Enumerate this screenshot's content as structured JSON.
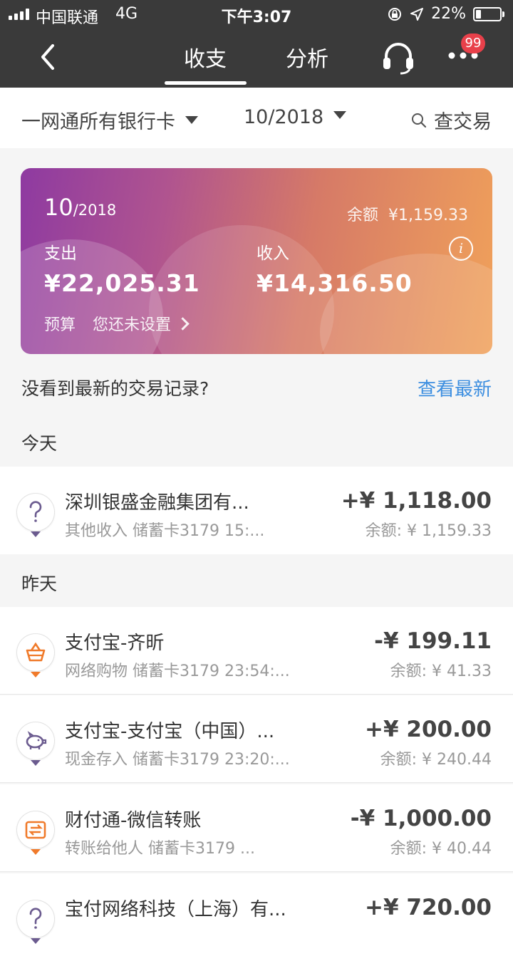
{
  "status_bar": {
    "carrier": "中国联通",
    "network": "4G",
    "time": "下午3:07",
    "battery": "22%"
  },
  "nav": {
    "tabs": [
      "收支",
      "分析"
    ],
    "active_tab": "收支",
    "badge": "99",
    "icons": [
      "back-icon",
      "headset-icon",
      "more-icon"
    ]
  },
  "filters": {
    "card": "一网通所有银行卡",
    "month": "10/2018",
    "search": "查交易"
  },
  "summary": {
    "month_main": "10",
    "month_year": "/2018",
    "balance_label": "余额",
    "balance": "¥1,159.33",
    "expense_label": "支出",
    "expense": "¥22,025.31",
    "income_label": "收入",
    "income": "¥14,316.50",
    "budget_label": "预算",
    "budget_value": "您还未设置"
  },
  "refresh": {
    "question": "没看到最新的交易记录?",
    "link": "查看最新"
  },
  "sections": {
    "today": "今天",
    "yesterday": "昨天"
  },
  "transactions": [
    {
      "title": "深圳银盛金融集团有...",
      "sub": "其他收入  储蓄卡3179 15:...",
      "amount": "+¥ 1,118.00",
      "balance": "余额: ¥ 1,159.33",
      "icon": "question-icon"
    },
    {
      "title": "支付宝-齐昕",
      "sub": "网络购物  储蓄卡3179 23:54:...",
      "amount": "-¥ 199.11",
      "balance": "余额: ¥ 41.33",
      "icon": "shopping-basket-icon"
    },
    {
      "title": "支付宝-支付宝（中国）...",
      "sub": "现金存入  储蓄卡3179 23:20:...",
      "amount": "+¥ 200.00",
      "balance": "余额: ¥ 240.44",
      "icon": "piggy-bank-icon"
    },
    {
      "title": "财付通-微信转账",
      "sub": "转账给他人  储蓄卡3179 ...",
      "amount": "-¥ 1,000.00",
      "balance": "余额: ¥ 40.44",
      "icon": "transfer-icon"
    },
    {
      "title": "宝付网络科技（上海）有...",
      "sub": "",
      "amount": "+¥ 720.00",
      "balance": "",
      "icon": "question-icon"
    }
  ],
  "colors": {
    "topbar": "#3a3a3a",
    "link": "#3c8ee0",
    "badge": "#e8404a",
    "orange_icon": "#f07a2a",
    "purple_icon": "#6b5b8f"
  }
}
